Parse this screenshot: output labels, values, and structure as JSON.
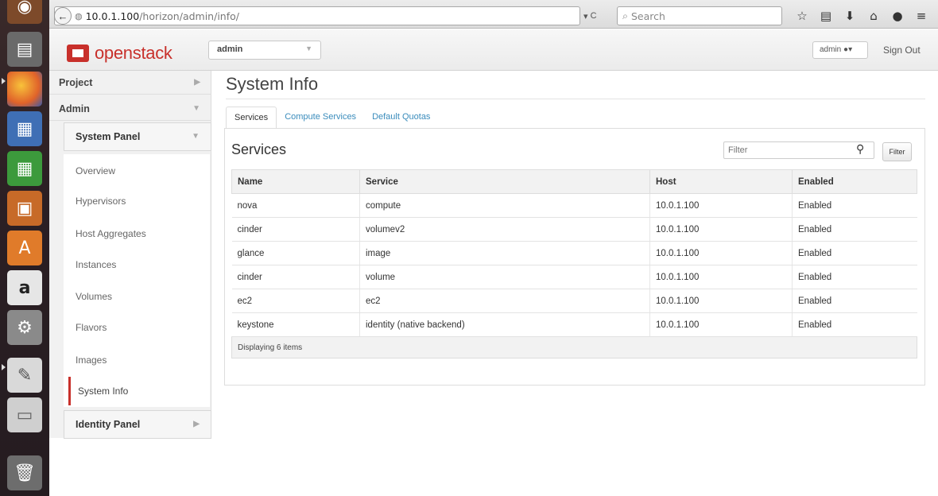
{
  "browser": {
    "url_host": "10.0.1.100",
    "url_path": "/horizon/admin/info/",
    "search_placeholder": "Search"
  },
  "header": {
    "logo_text": "openstack",
    "project": "admin",
    "user": "admin",
    "sign_out": "Sign Out"
  },
  "sidebar": {
    "dashboards": [
      "Project",
      "Admin"
    ],
    "panel_groups": [
      "System Panel",
      "Identity Panel"
    ],
    "items": [
      "Overview",
      "Hypervisors",
      "Host Aggregates",
      "Instances",
      "Volumes",
      "Flavors",
      "Images",
      "System Info"
    ],
    "active_item": "System Info"
  },
  "main": {
    "title": "System Info",
    "tabs": [
      "Services",
      "Compute Services",
      "Default Quotas"
    ],
    "active_tab": "Services",
    "table_title": "Services",
    "filter_placeholder": "Filter",
    "filter_button": "Filter",
    "columns": [
      "Name",
      "Service",
      "Host",
      "Enabled"
    ],
    "rows": [
      [
        "nova",
        "compute",
        "10.0.1.100",
        "Enabled"
      ],
      [
        "cinder",
        "volumev2",
        "10.0.1.100",
        "Enabled"
      ],
      [
        "glance",
        "image",
        "10.0.1.100",
        "Enabled"
      ],
      [
        "cinder",
        "volume",
        "10.0.1.100",
        "Enabled"
      ],
      [
        "ec2",
        "ec2",
        "10.0.1.100",
        "Enabled"
      ],
      [
        "keystone",
        "identity (native backend)",
        "10.0.1.100",
        "Enabled"
      ]
    ],
    "footer": "Displaying 6 items"
  },
  "colors": {
    "brand": "#c8302b",
    "link": "#3a8cbc"
  }
}
